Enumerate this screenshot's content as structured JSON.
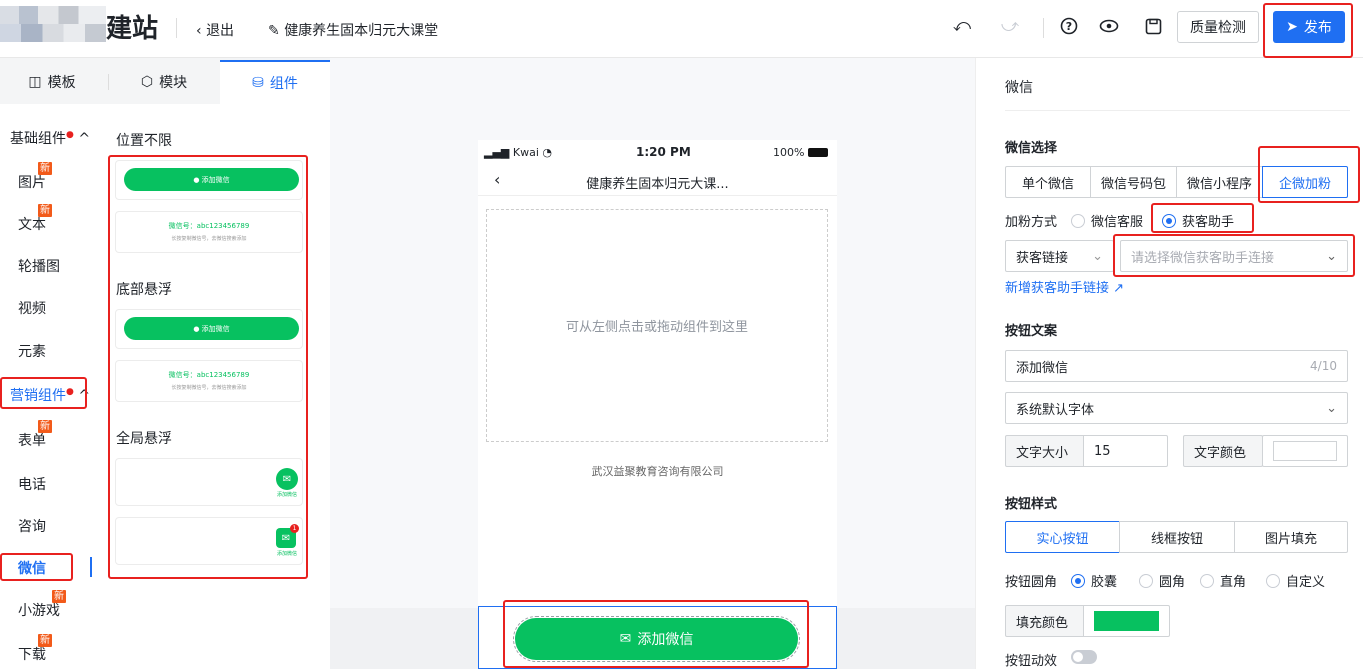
{
  "header": {
    "brand": "建站",
    "back_label": "退出",
    "page_name": "健康养生固本归元大课堂",
    "qc_label": "质量检测",
    "publish_label": "发布",
    "icons": [
      "undo-icon",
      "redo-icon",
      "help-icon",
      "preview-eye-icon",
      "save-icon",
      "send-icon"
    ]
  },
  "left_tabs": [
    {
      "label": "模板",
      "icon": "template-icon"
    },
    {
      "label": "模块",
      "icon": "cube-icon"
    },
    {
      "label": "组件",
      "icon": "database-icon"
    }
  ],
  "categories": [
    {
      "label": "基础组件",
      "group": true
    },
    {
      "label": "图片",
      "new": true
    },
    {
      "label": "文本",
      "new": true
    },
    {
      "label": "轮播图"
    },
    {
      "label": "视频"
    },
    {
      "label": "元素"
    },
    {
      "label": "营销组件",
      "group": true
    },
    {
      "label": "表单",
      "new": true
    },
    {
      "label": "电话"
    },
    {
      "label": "咨询"
    },
    {
      "label": "微信",
      "active": true
    },
    {
      "label": "小游戏",
      "new": true
    },
    {
      "label": "下载",
      "new": true
    }
  ],
  "new_tag": "新",
  "sections": {
    "s1": "位置不限",
    "s2": "底部悬浮",
    "s3": "全局悬浮"
  },
  "samples": {
    "add_wechat": "添加微信",
    "wx_id": "微信号：abc123456789",
    "wx_hint": "长按复制微信号，去微信搜索添加",
    "float_label": "添加微信",
    "badge": "1"
  },
  "phone": {
    "carrier": "Kwai",
    "time": "1:20 PM",
    "battery": "100%",
    "title": "健康养生固本归元大课...",
    "drop_hint": "可从左侧点击或拖动组件到这里",
    "company": "武汉益聚教育咨询有限公司",
    "cta": "添加微信"
  },
  "panel": {
    "title": "微信",
    "select_heading": "微信选择",
    "wechat_types": [
      "单个微信",
      "微信号码包",
      "微信小程序",
      "企微加粉"
    ],
    "fan_method_label": "加粉方式",
    "fan_methods": [
      "微信客服",
      "获客助手"
    ],
    "link_type": "获客链接",
    "link_placeholder": "请选择微信获客助手连接",
    "add_link": "新增获客助手链接",
    "btn_text_heading": "按钮文案",
    "btn_text_value": "添加微信",
    "btn_text_count": "4/10",
    "font_value": "系统默认字体",
    "font_size_label": "文字大小",
    "font_size_value": "15",
    "font_color_label": "文字颜色",
    "style_heading": "按钮样式",
    "styles": [
      "实心按钮",
      "线框按钮",
      "图片填充"
    ],
    "corner_label": "按钮圆角",
    "corners": [
      "胶囊",
      "圆角",
      "直角",
      "自定义"
    ],
    "fill_label": "填充颜色",
    "fill_color": "#07c160",
    "anim_label": "按钮动效"
  },
  "colors": {
    "accent": "#1f6ff2",
    "wechat_green": "#07c160",
    "highlight": "#e8211f"
  }
}
